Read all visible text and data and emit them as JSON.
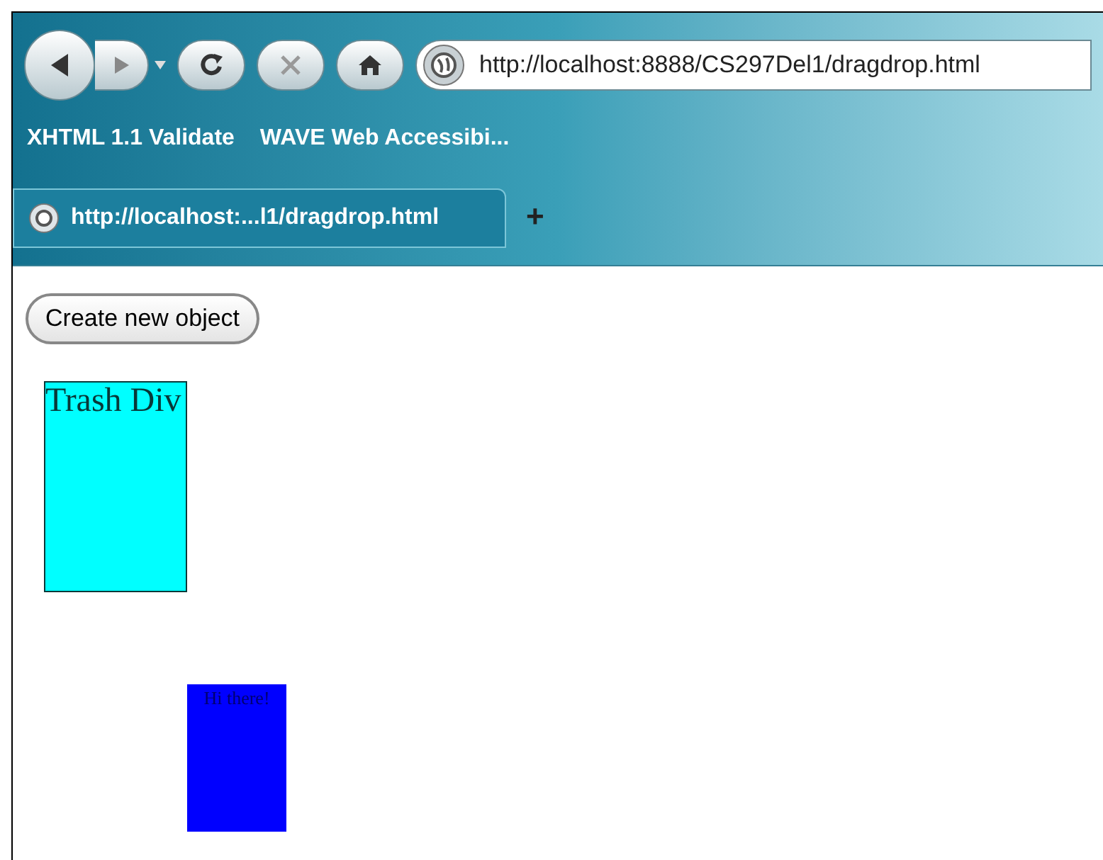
{
  "toolbar": {
    "address": "http://localhost:8888/CS297Del1/dragdrop.html"
  },
  "bookmarks": [
    "XHTML 1.1 Validate",
    "WAVE Web Accessibi..."
  ],
  "tabs": [
    {
      "label": "http://localhost:...l1/dragdrop.html",
      "selected": true
    }
  ],
  "new_tab": "+",
  "page": {
    "button": "Create new object",
    "trash": "Trash Div",
    "object": "Hi there!"
  }
}
